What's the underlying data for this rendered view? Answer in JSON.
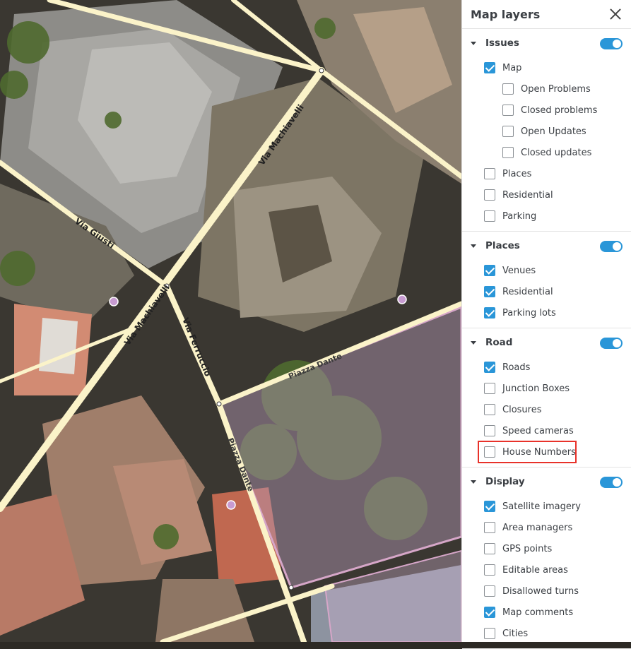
{
  "panel": {
    "title": "Map layers",
    "groups": [
      {
        "label": "Issues",
        "enabled": true,
        "items": [
          {
            "label": "Map",
            "checked": true,
            "level": 1
          },
          {
            "label": "Open Problems",
            "checked": false,
            "level": 2
          },
          {
            "label": "Closed problems",
            "checked": false,
            "level": 2
          },
          {
            "label": "Open Updates",
            "checked": false,
            "level": 2
          },
          {
            "label": "Closed updates",
            "checked": false,
            "level": 2
          },
          {
            "label": "Places",
            "checked": false,
            "level": 1
          },
          {
            "label": "Residential",
            "checked": false,
            "level": 1
          },
          {
            "label": "Parking",
            "checked": false,
            "level": 1
          }
        ]
      },
      {
        "label": "Places",
        "enabled": true,
        "items": [
          {
            "label": "Venues",
            "checked": true,
            "level": 1
          },
          {
            "label": "Residential",
            "checked": true,
            "level": 1
          },
          {
            "label": "Parking lots",
            "checked": true,
            "level": 1
          }
        ]
      },
      {
        "label": "Road",
        "enabled": true,
        "items": [
          {
            "label": "Roads",
            "checked": true,
            "level": 1
          },
          {
            "label": "Junction Boxes",
            "checked": false,
            "level": 1
          },
          {
            "label": "Closures",
            "checked": false,
            "level": 1
          },
          {
            "label": "Speed cameras",
            "checked": false,
            "level": 1
          },
          {
            "label": "House Numbers",
            "checked": false,
            "level": 1,
            "highlighted": true
          }
        ]
      },
      {
        "label": "Display",
        "enabled": true,
        "items": [
          {
            "label": "Satellite imagery",
            "checked": true,
            "level": 1
          },
          {
            "label": "Area managers",
            "checked": false,
            "level": 1
          },
          {
            "label": "GPS points",
            "checked": false,
            "level": 1
          },
          {
            "label": "Editable areas",
            "checked": false,
            "level": 1
          },
          {
            "label": "Disallowed turns",
            "checked": false,
            "level": 1
          },
          {
            "label": "Map comments",
            "checked": true,
            "level": 1
          },
          {
            "label": "Cities",
            "checked": false,
            "level": 1
          }
        ]
      }
    ]
  },
  "map": {
    "street_labels": {
      "via_machiavelli_upper": "Via Machiavelli",
      "via_giusti": "Via Giusti",
      "via_machiavelli_lower": "Via Machiavelli",
      "via_ferruccio": "Via Ferruccio",
      "piazza_dante_top": "Piazza Dante",
      "piazza_dante_side": "Piazza Dante"
    }
  },
  "colors": {
    "accent": "#2a96d8",
    "highlight": "#e8322a",
    "road": "#fbf3c9",
    "plaza_fill": "#b59ab8",
    "place_marker": "#c79bd1"
  }
}
